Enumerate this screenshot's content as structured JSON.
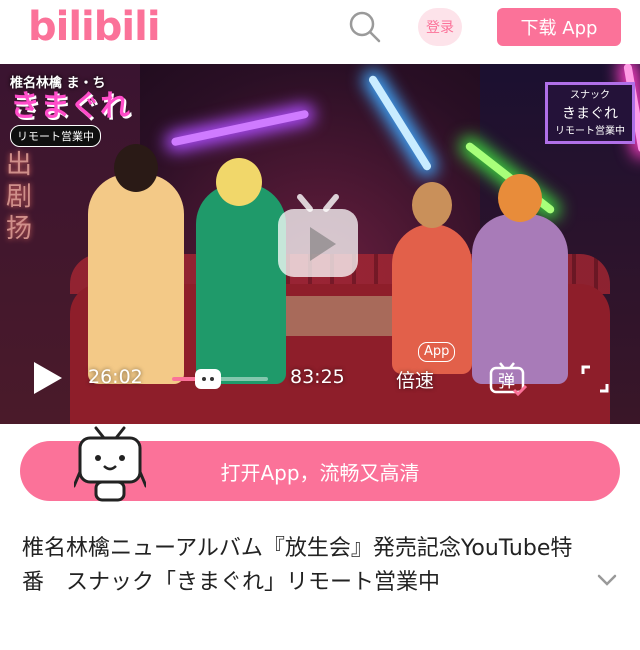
{
  "header": {
    "logo_text": "bilibili",
    "search_icon": "search-icon",
    "login_label": "登录",
    "download_label": "下载 App",
    "brand_color": "#fb7299"
  },
  "video": {
    "show_brand_small": "椎名林檎",
    "show_brand_top": "ま・ち",
    "show_title": "きまぐれ",
    "live_badge": "リモート営業中",
    "neon_kanji": [
      "出",
      "剧",
      "扬"
    ],
    "sign_main": "きまぐれ",
    "sign_top": "スナック",
    "sign_sub": "リモート営業中",
    "center_icon": "play-logo-icon",
    "app_badge": "App"
  },
  "controls": {
    "play_icon": "play-icon",
    "current_time": "26:02",
    "total_time": "83:25",
    "progress": 0.312,
    "speed_label": "倍速",
    "danmaku_label": "弹",
    "fullscreen_icon": "fullscreen-icon"
  },
  "banner": {
    "open_app_label": "打开App，流畅又高清",
    "mascot_icon": "tv-mascot-icon"
  },
  "title": {
    "text": "椎名林檎ニューアルバム『放生会』発売記念YouTube特番　スナック「きまぐれ」リモート営業中",
    "expand_icon": "chevron-down-icon"
  }
}
